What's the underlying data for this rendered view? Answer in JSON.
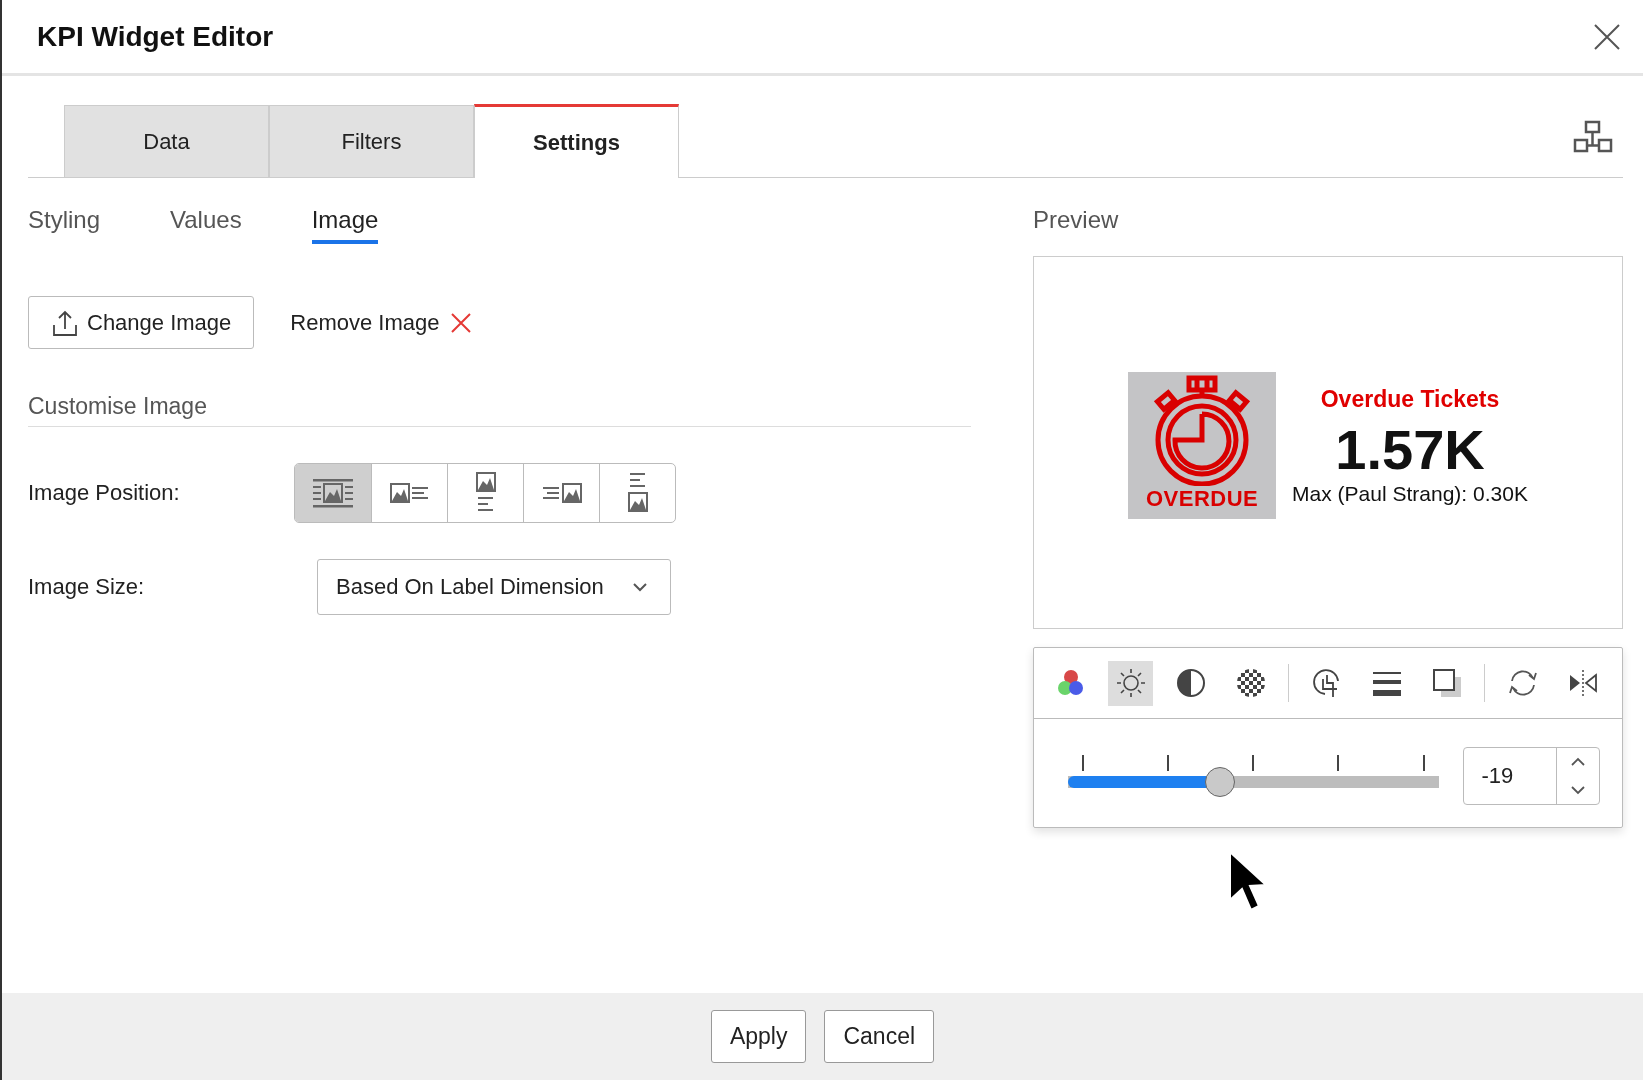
{
  "window": {
    "title": "KPI Widget Editor"
  },
  "tabs": [
    {
      "label": "Data",
      "selected": false
    },
    {
      "label": "Filters",
      "selected": false
    },
    {
      "label": "Settings",
      "selected": true
    }
  ],
  "subtabs": [
    {
      "label": "Styling",
      "selected": false
    },
    {
      "label": "Values",
      "selected": false
    },
    {
      "label": "Image",
      "selected": true
    }
  ],
  "change_image_button": "Change Image",
  "remove_image_button": "Remove Image",
  "section_title": "Customise Image",
  "image_position": {
    "label": "Image Position:",
    "options": [
      {
        "kind": "center",
        "selected": true
      },
      {
        "kind": "left",
        "selected": false
      },
      {
        "kind": "top",
        "selected": false
      },
      {
        "kind": "right",
        "selected": false
      },
      {
        "kind": "bottom",
        "selected": false
      }
    ]
  },
  "image_size": {
    "label": "Image Size:",
    "value": "Based On Label Dimension"
  },
  "preview": {
    "label": "Preview",
    "image_caption": "OVERDUE",
    "title": "Overdue Tickets",
    "value": "1.57K",
    "subtitle": "Max (Paul Strang): 0.30K"
  },
  "tools": [
    {
      "kind": "colors",
      "selected": false
    },
    {
      "kind": "brightness",
      "selected": true
    },
    {
      "kind": "contrast",
      "selected": false
    },
    {
      "kind": "transparency",
      "selected": false
    },
    {
      "kind": "divider"
    },
    {
      "kind": "crop",
      "selected": false
    },
    {
      "kind": "lines",
      "selected": false
    },
    {
      "kind": "shadow",
      "selected": false
    },
    {
      "kind": "divider"
    },
    {
      "kind": "rotate",
      "selected": false
    },
    {
      "kind": "flip",
      "selected": false
    }
  ],
  "slider": {
    "level": 0.41,
    "value": "-19"
  },
  "buttons": [
    "Apply",
    "Cancel"
  ]
}
